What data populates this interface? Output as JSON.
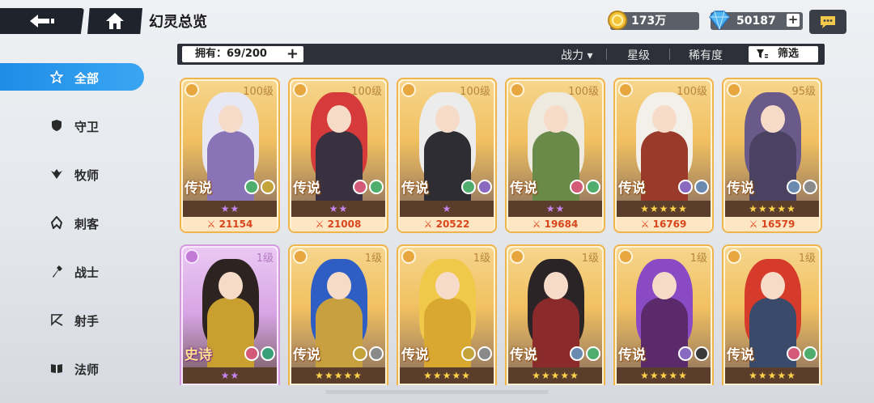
{
  "header": {
    "title": "幻灵总览",
    "gold": "173万",
    "gems": "50187",
    "back_icon": "back-arrow-icon",
    "home_icon": "home-icon",
    "chat_icon": "chat-icon"
  },
  "filter": {
    "owned": "拥有：69/200",
    "sort_power": "战力 ▾",
    "sort_star": "星级",
    "sort_rarity": "稀有度",
    "screen": "筛选"
  },
  "sidebar": {
    "items": [
      {
        "label": "全部",
        "icon": "all-star-icon",
        "active": true
      },
      {
        "label": "守卫",
        "icon": "guard-shield-icon",
        "active": false
      },
      {
        "label": "牧师",
        "icon": "priest-wings-icon",
        "active": false
      },
      {
        "label": "刺客",
        "icon": "assassin-icon",
        "active": false
      },
      {
        "label": "战士",
        "icon": "warrior-axe-icon",
        "active": false
      },
      {
        "label": "射手",
        "icon": "archer-bow-icon",
        "active": false
      },
      {
        "label": "法师",
        "icon": "mage-book-icon",
        "active": false
      }
    ]
  },
  "colors": {
    "accent": "#2a97ec",
    "legend_border": "#efb44a",
    "epic_border": "#d49ae0",
    "power_text": "#d8461d"
  },
  "cards": [
    {
      "level": "100级",
      "rarity": "传说",
      "stars": 2,
      "star_color": "purple",
      "power": "21154",
      "hair": "#e8e8f4",
      "outfit": "#8a74b8",
      "elem1": "#4fae6d",
      "elem2": "#c4a43a",
      "epic": false
    },
    {
      "level": "100级",
      "rarity": "传说",
      "stars": 2,
      "star_color": "purple",
      "power": "21008",
      "hair": "#d63a3a",
      "outfit": "#3a3140",
      "elem1": "#d45a7a",
      "elem2": "#4fae6d",
      "epic": false
    },
    {
      "level": "100级",
      "rarity": "传说",
      "stars": 1,
      "star_color": "purple",
      "power": "20522",
      "hair": "#ececec",
      "outfit": "#2d2d33",
      "elem1": "#4fae6d",
      "elem2": "#8a6ac0",
      "epic": false
    },
    {
      "level": "100级",
      "rarity": "传说",
      "stars": 2,
      "star_color": "purple",
      "power": "19684",
      "hair": "#efeae0",
      "outfit": "#6a8a4a",
      "elem1": "#d45a7a",
      "elem2": "#4fae6d",
      "epic": false
    },
    {
      "level": "100级",
      "rarity": "传说",
      "stars": 5,
      "star_color": "gold",
      "power": "16769",
      "hair": "#f3f0ea",
      "outfit": "#9a3a2a",
      "elem1": "#8a6ac0",
      "elem2": "#6a8ab0",
      "epic": false
    },
    {
      "level": "95级",
      "rarity": "传说",
      "stars": 5,
      "star_color": "gold",
      "power": "16579",
      "hair": "#6a5a8a",
      "outfit": "#4a4260",
      "elem1": "#6a8ab0",
      "elem2": "#8a8a8a",
      "epic": false
    },
    {
      "level": "1级",
      "rarity": "史诗",
      "stars": 2,
      "star_color": "purple",
      "power": "",
      "hair": "#2d2320",
      "outfit": "#c9a030",
      "elem1": "#d45a7a",
      "elem2": "#3aa07a",
      "epic": true
    },
    {
      "level": "1级",
      "rarity": "传说",
      "stars": 5,
      "star_color": "gold",
      "power": "",
      "hair": "#2e5ec4",
      "outfit": "#c8a040",
      "elem1": "#c4a43a",
      "elem2": "#8a8a8a",
      "epic": false
    },
    {
      "level": "1级",
      "rarity": "传说",
      "stars": 5,
      "star_color": "gold",
      "power": "",
      "hair": "#f0c84a",
      "outfit": "#d8a830",
      "elem1": "#c4a43a",
      "elem2": "#8a8a8a",
      "epic": false
    },
    {
      "level": "1级",
      "rarity": "传说",
      "stars": 5,
      "star_color": "gold",
      "power": "",
      "hair": "#2a2426",
      "outfit": "#8a2a2a",
      "elem1": "#6a8ab0",
      "elem2": "#4fae6d",
      "epic": false
    },
    {
      "level": "1级",
      "rarity": "传说",
      "stars": 5,
      "star_color": "gold",
      "power": "",
      "hair": "#8a4ac4",
      "outfit": "#5a2a6a",
      "elem1": "#8a6ac0",
      "elem2": "#3a3a3a",
      "epic": false
    },
    {
      "level": "1级",
      "rarity": "传说",
      "stars": 5,
      "star_color": "gold",
      "power": "",
      "hair": "#d63a2a",
      "outfit": "#3a4a6a",
      "elem1": "#d45a7a",
      "elem2": "#4fae6d",
      "epic": false
    }
  ]
}
